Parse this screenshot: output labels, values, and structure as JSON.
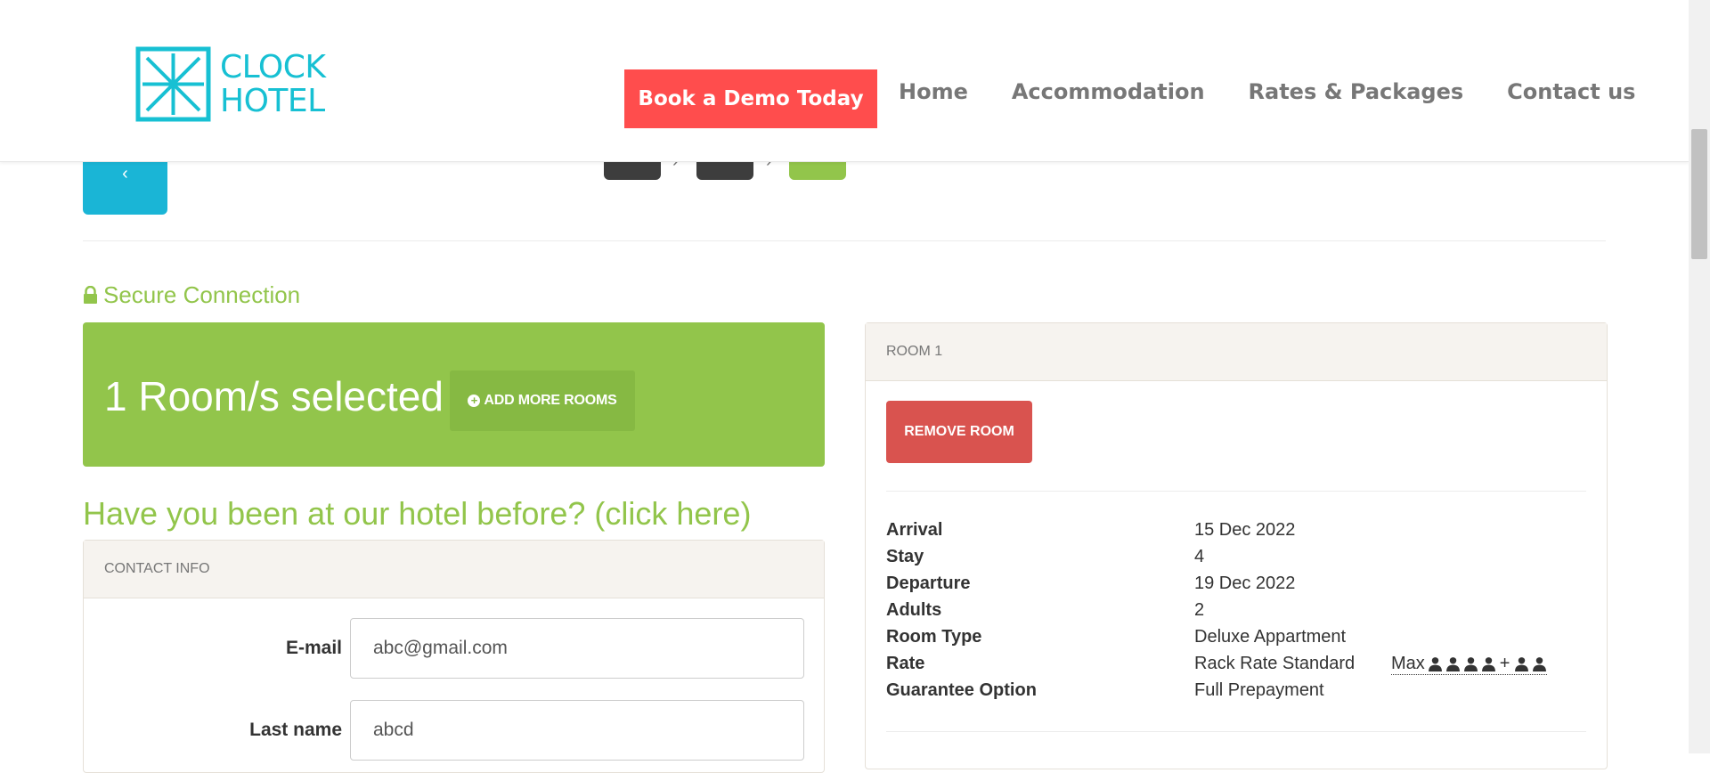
{
  "header": {
    "logo": {
      "line1": "CLOCK",
      "line2": "HOTEL"
    },
    "demo_button": "Book a Demo Today",
    "nav": [
      "Home",
      "Accommodation",
      "Rates & Packages",
      "Contact us"
    ]
  },
  "steps": {
    "back_icon": "chevron-left-icon",
    "separator": "›"
  },
  "secure": {
    "label": "Secure Connection",
    "icon": "lock-icon"
  },
  "rooms_box": {
    "title": "1 Room/s selected",
    "add_button": "ADD MORE ROOMS"
  },
  "been_before": "Have you been at our hotel before? (click here)",
  "contact": {
    "header": "CONTACT INFO",
    "fields": [
      {
        "label": "E-mail",
        "value": "abc@gmail.com"
      },
      {
        "label": "Last name",
        "value": "abcd"
      }
    ]
  },
  "room": {
    "header": "ROOM 1",
    "remove_button": "REMOVE ROOM",
    "details": [
      {
        "key": "Arrival",
        "value": "15 Dec 2022"
      },
      {
        "key": "Stay",
        "value": "4"
      },
      {
        "key": "Departure",
        "value": "19 Dec 2022"
      },
      {
        "key": "Adults",
        "value": "2"
      },
      {
        "key": "Room Type",
        "value": "Deluxe Appartment"
      },
      {
        "key": "Rate",
        "value": "Rack Rate Standard"
      },
      {
        "key": "Guarantee Option",
        "value": "Full Prepayment"
      }
    ],
    "max_label": "Max",
    "max_plus": "+"
  },
  "colors": {
    "accent_green": "#92c54b",
    "cyan": "#1ab5d6",
    "red": "#ff4d4d",
    "remove_red": "#d9534f"
  }
}
